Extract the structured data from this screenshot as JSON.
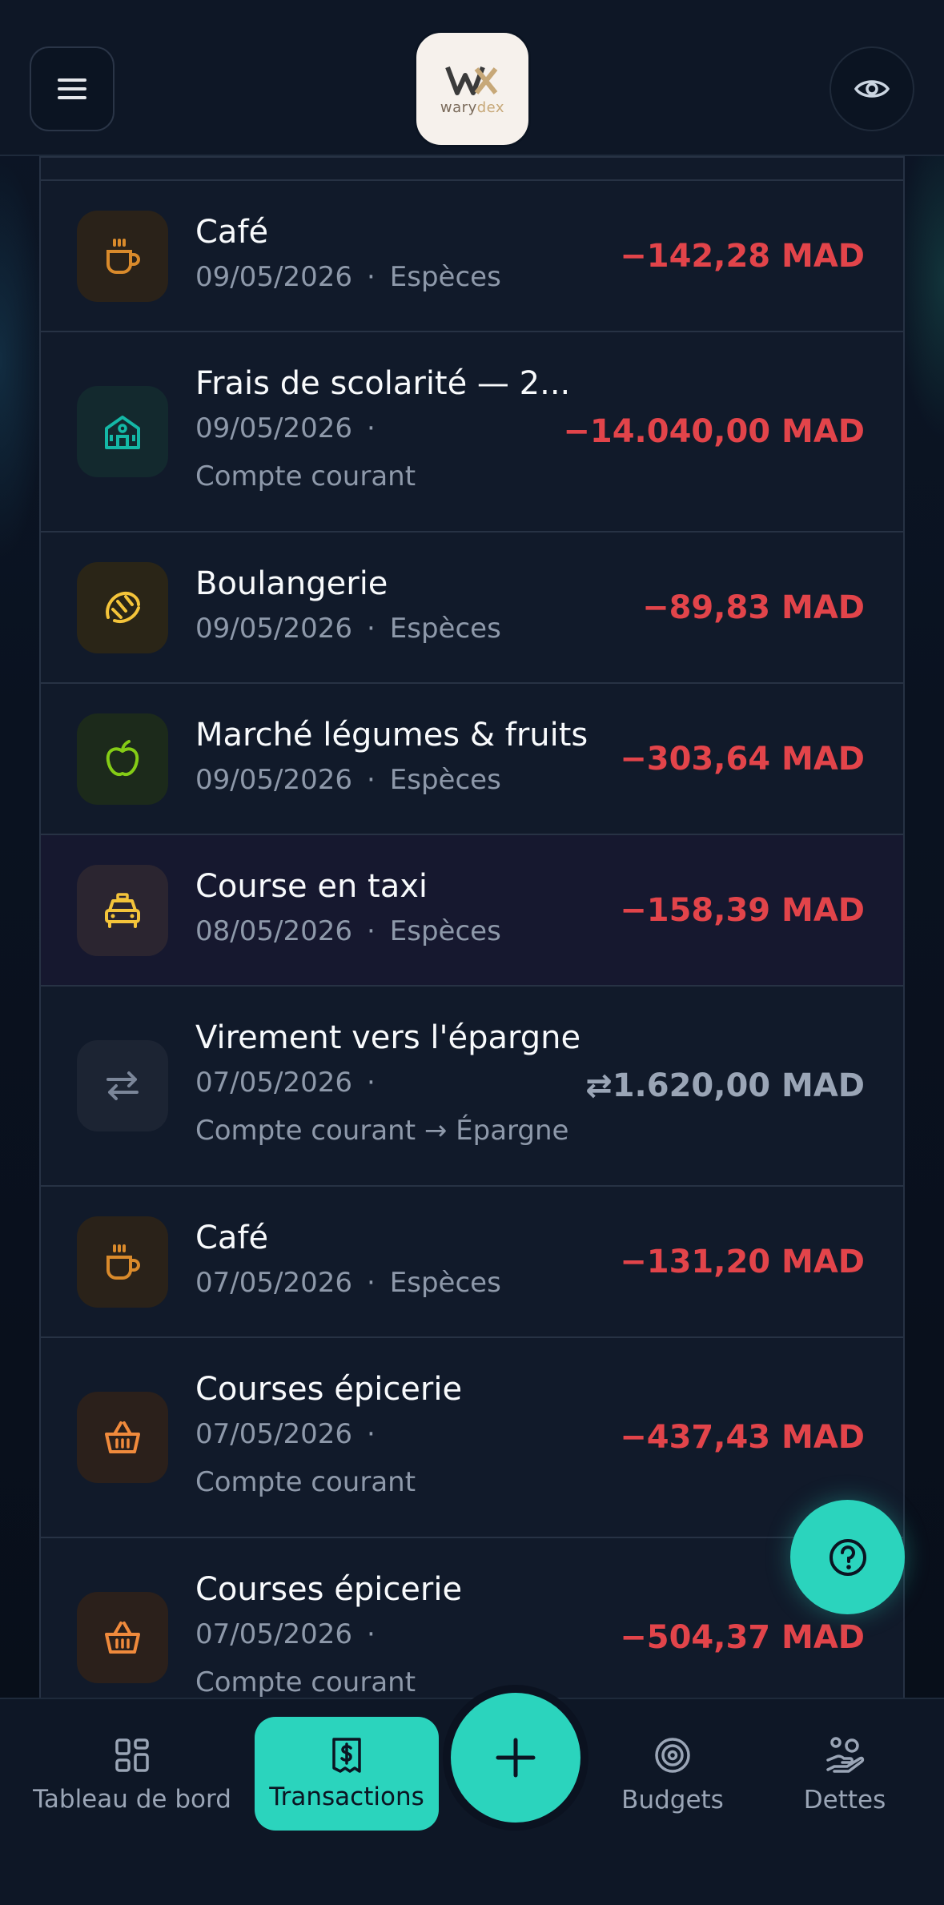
{
  "header": {
    "logo_text_main": "wary",
    "logo_text_accent": "dex"
  },
  "transactions": [
    {
      "title": "Café",
      "date": "09/05/2026",
      "account": "Espèces",
      "amount": "−142,28 MAD",
      "icon": "coffee-icon",
      "icon_color": "#d98a2b"
    },
    {
      "title": "Frais de scolarité — 2...",
      "date": "09/05/2026",
      "account": "Compte courant",
      "amount": "−14.040,00 MAD",
      "icon": "school-icon",
      "icon_color": "#14b8a6"
    },
    {
      "title": "Boulangerie",
      "date": "09/05/2026",
      "account": "Espèces",
      "amount": "−89,83 MAD",
      "icon": "croissant-icon",
      "icon_color": "#f4c43a"
    },
    {
      "title": "Marché légumes & fruits",
      "date": "09/05/2026",
      "account": "Espèces",
      "amount": "−303,64 MAD",
      "icon": "apple-icon",
      "icon_color": "#84cc16"
    },
    {
      "title": "Course en taxi",
      "date": "08/05/2026",
      "account": "Espèces",
      "amount": "−158,39 MAD",
      "icon": "taxi-icon",
      "icon_color": "#f4c43a"
    },
    {
      "title": "Virement vers l'épargne",
      "date": "07/05/2026",
      "account": "Compte courant → Épargne",
      "amount": "⇄1.620,00 MAD",
      "icon": "transfer-icon",
      "icon_color": "#7b8699"
    },
    {
      "title": "Café",
      "date": "07/05/2026",
      "account": "Espèces",
      "amount": "−131,20 MAD",
      "icon": "coffee-icon",
      "icon_color": "#d98a2b"
    },
    {
      "title": "Courses épicerie",
      "date": "07/05/2026",
      "account": "Compte courant",
      "amount": "−437,43 MAD",
      "icon": "basket-icon",
      "icon_color": "#f08a3c"
    },
    {
      "title": "Courses épicerie",
      "date": "07/05/2026",
      "account": "Compte courant",
      "amount": "−504,37 MAD",
      "icon": "basket-icon",
      "icon_color": "#f08a3c"
    }
  ],
  "meta_separator": "·",
  "nav": {
    "dashboard": "Tableau de bord",
    "transactions": "Transactions",
    "budgets": "Budgets",
    "debts": "Dettes"
  },
  "colors": {
    "accent": "#2bd4bd",
    "expense": "#e2444a",
    "neutral": "#9aa5b6"
  }
}
